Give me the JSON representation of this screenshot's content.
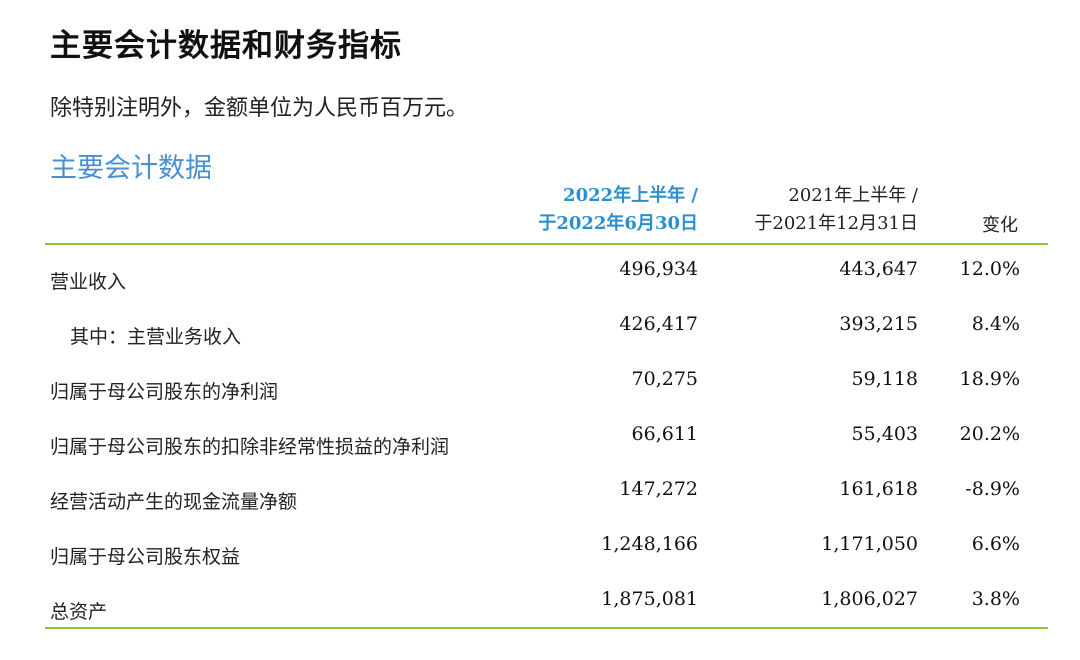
{
  "title": "主要会计数据和财务指标",
  "note": "除特别注明外，金额单位为人民币百万元。",
  "section": "主要会计数据",
  "table": {
    "headers": {
      "current_line1": "2022年上半年 /",
      "current_line2": "于2022年6月30日",
      "previous_line1": "2021年上半年 /",
      "previous_line2": "于2021年12月31日",
      "change": "变化"
    },
    "rows": [
      {
        "label": "营业收入",
        "current": "496,934",
        "previous": "443,647",
        "change": "12.0%"
      },
      {
        "label": "其中：主营业务收入",
        "current": "426,417",
        "previous": "393,215",
        "change": "8.4%"
      },
      {
        "label": "归属于母公司股东的净利润",
        "current": "70,275",
        "previous": "59,118",
        "change": "18.9%"
      },
      {
        "label": "归属于母公司股东的扣除非经常性损益的净利润",
        "current": "66,611",
        "previous": "55,403",
        "change": "20.2%"
      },
      {
        "label": "经营活动产生的现金流量净额",
        "current": "147,272",
        "previous": "161,618",
        "change": "-8.9%"
      },
      {
        "label": "归属于母公司股东权益",
        "current": "1,248,166",
        "previous": "1,171,050",
        "change": "6.6%"
      },
      {
        "label": "总资产",
        "current": "1,875,081",
        "previous": "1,806,027",
        "change": "3.8%"
      }
    ]
  },
  "colors": {
    "section": "#4a8fd1",
    "current_header": "#2a8fd0",
    "rule": "#8fc63f"
  }
}
